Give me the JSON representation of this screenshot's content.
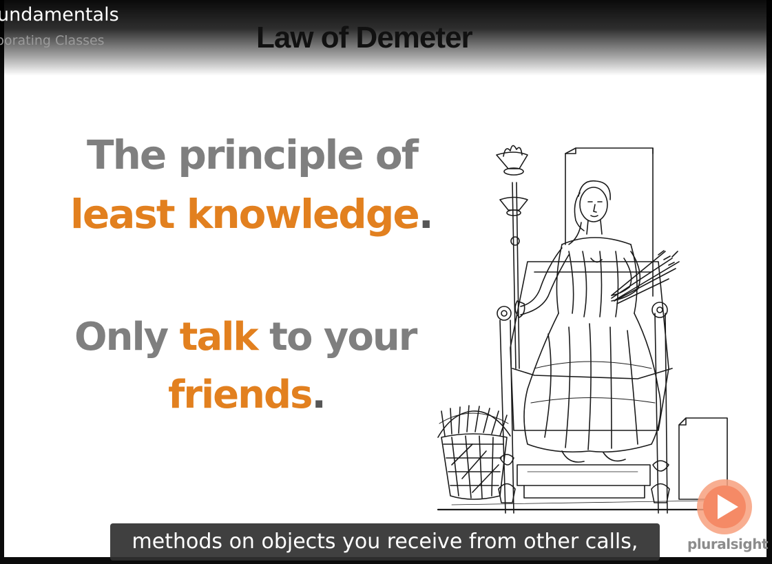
{
  "player": {
    "course_title": "undamentals",
    "module_title": "borating Classes",
    "brand": "pluralsight"
  },
  "slide": {
    "title": "Law of Demeter",
    "line1": "The principle of",
    "line2_highlight": "least knowledge",
    "line2_end": ".",
    "line3_start": "Only ",
    "line3_highlight": "talk",
    "line3_end": " to your",
    "line4_highlight": "friends",
    "line4_end": ".",
    "illustration": "demeter-enthroned-engraving"
  },
  "caption": {
    "text": "methods on objects you receive from other calls,"
  },
  "colors": {
    "accent_orange": "#e2801f",
    "text_gray": "#7f7f7f",
    "brand_orange": "#f26b3a"
  }
}
